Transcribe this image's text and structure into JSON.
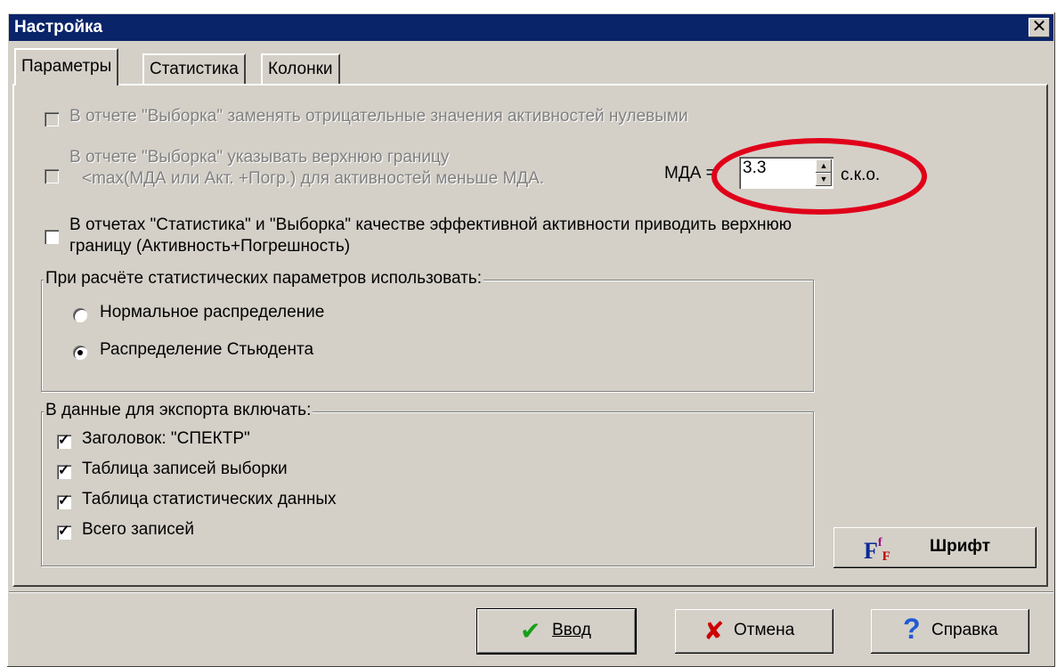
{
  "window": {
    "title": "Настройка",
    "close_glyph": "✕"
  },
  "tabs": [
    {
      "label": "Параметры",
      "active": true
    },
    {
      "label": "Статистика",
      "active": false
    },
    {
      "label": "Колонки",
      "active": false
    }
  ],
  "options": {
    "replace_negative": {
      "label": "В отчете \"Выборка\" заменять отрицательные значения активностей нулевыми",
      "checked": false,
      "enabled": false
    },
    "upper_bound": {
      "label_line1": "В отчете \"Выборка\" указывать верхнюю границу",
      "label_line2": "<max(МДА или Акт. +Погр.) для активностей меньше МДА.",
      "checked": false,
      "enabled": false
    },
    "mda": {
      "label": "МДА =",
      "value": "3.3",
      "unit": "с.к.о."
    },
    "effective_activity": {
      "label_line1": "В отчетах \"Статистика\" и \"Выборка\" качестве эффективной активности приводить верхнюю",
      "label_line2": "границу  (Активность+Погрешность)",
      "checked": false
    }
  },
  "stats_group": {
    "title": "При расчёте статистических параметров использовать:",
    "options": [
      {
        "label": "Нормальное распределение",
        "selected": false
      },
      {
        "label": "Распределение Стьюдента",
        "selected": true
      }
    ]
  },
  "export_group": {
    "title": "В данные для экспорта включать:",
    "items": [
      {
        "label": "Заголовок: \"СПЕКТР\"",
        "checked": true
      },
      {
        "label": "Таблица записей выборки",
        "checked": true
      },
      {
        "label": "Таблица статистических данных",
        "checked": true
      },
      {
        "label": "Всего записей",
        "checked": true
      }
    ]
  },
  "font_button": {
    "label": "Шрифт",
    "icon_glyph": "F",
    "icon_sup": "f",
    "icon_sub": "F"
  },
  "buttons": {
    "ok": {
      "label": "Ввод",
      "icon_glyph": "✔",
      "icon_color": "#16a016"
    },
    "cancel": {
      "label": "Отмена",
      "icon_glyph": "✘",
      "icon_color": "#cc0000"
    },
    "help": {
      "label": "Справка",
      "icon_glyph": "?",
      "icon_color": "#1e5bd6"
    }
  },
  "annotation_color": "#e0001a"
}
